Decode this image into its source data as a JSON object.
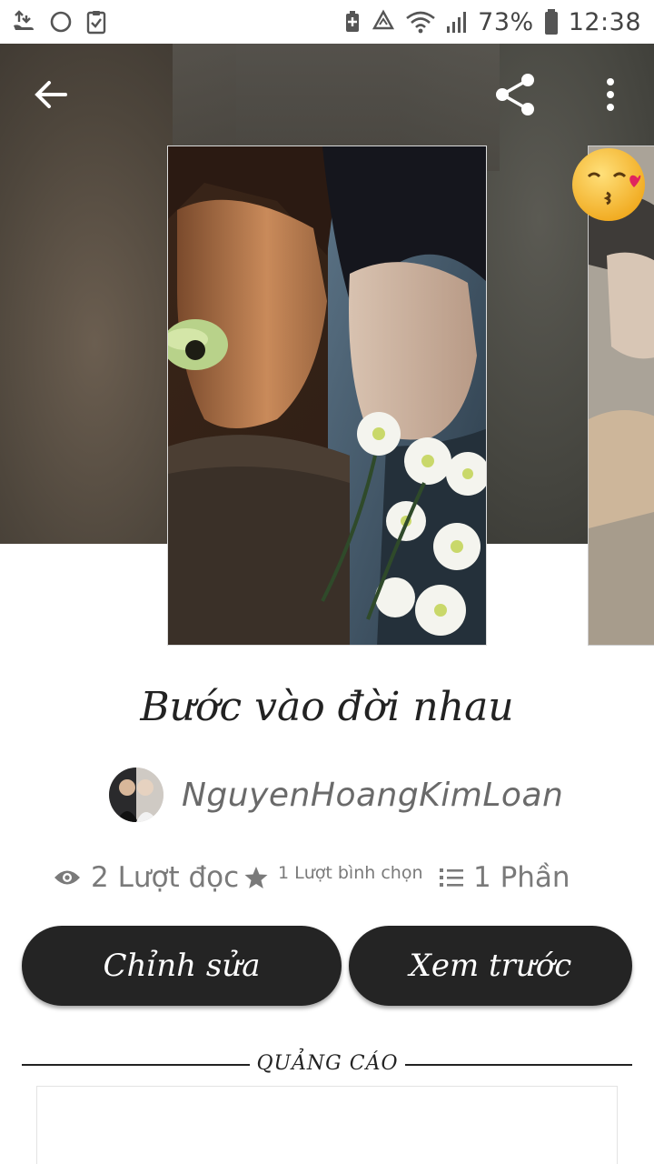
{
  "status_bar": {
    "battery_percent": "73%",
    "time": "12:38",
    "icons": [
      "usb-debug-icon",
      "circle-icon",
      "clipboard-check-icon",
      "battery-saver-icon",
      "recycle-icon",
      "wifi-icon",
      "signal-icon",
      "battery-icon"
    ]
  },
  "header": {
    "icons": [
      "back-arrow-icon",
      "share-icon",
      "more-vertical-icon"
    ]
  },
  "story": {
    "title": "Bước vào đời nhau",
    "author": "NguyenHoangKimLoan"
  },
  "stats": {
    "reads": "2 Lượt đọc",
    "votes": "1 Lượt bình chọn",
    "parts": "1 Phần"
  },
  "actions": {
    "edit_label": "Chỉnh sửa",
    "preview_label": "Xem trước"
  },
  "ad": {
    "label": "QUẢNG CÁO"
  },
  "colors": {
    "button_bg": "#242424",
    "button_text": "#ffffff",
    "stat_text": "#7a7a7a",
    "author_text": "#6a6a6a"
  }
}
